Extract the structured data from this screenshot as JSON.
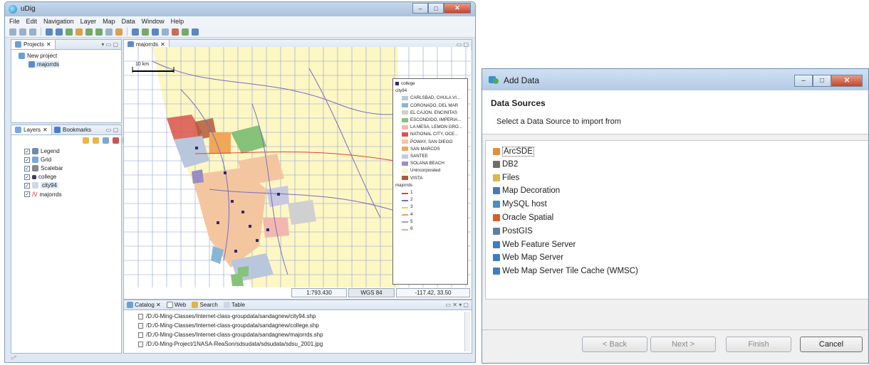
{
  "udig": {
    "title": "uDig",
    "menu": [
      "File",
      "Edit",
      "Navigation",
      "Layer",
      "Map",
      "Data",
      "Window",
      "Help"
    ],
    "projects": {
      "tab_label": "Projects",
      "items": [
        "New project",
        "majorrds"
      ]
    },
    "layers": {
      "tab_label": "Layers",
      "bookmarks_label": "Bookmarks",
      "items": [
        "Legend",
        "Grid",
        "Scalebar",
        "college",
        "city94",
        "majorrds"
      ]
    },
    "map": {
      "tab_label": "majorrds",
      "scalebar_label": "10 km",
      "scale": "1:793.430",
      "crs": "WGS 84",
      "coords": "-117.42, 33.50"
    },
    "legend": {
      "college_label": "college",
      "city_layer": "city94",
      "cities": [
        {
          "name": "CARLSBAD, CHULA VI...",
          "color": "#b9c7dd"
        },
        {
          "name": "CORONADO, DEL MAR",
          "color": "#8ab6d6"
        },
        {
          "name": "EL CAJON, ENCINITAS",
          "color": "#d0d0d0"
        },
        {
          "name": "ESCONDIDO, IMPERIA...",
          "color": "#86c27a"
        },
        {
          "name": "LA MESA, LEMON GRO...",
          "color": "#f2b8b0"
        },
        {
          "name": "NATIONAL CITY, OCE...",
          "color": "#d9534f"
        },
        {
          "name": "POWAY, SAN DIEGO",
          "color": "#f4c6a0"
        },
        {
          "name": "SAN MARCOS",
          "color": "#f0a858"
        },
        {
          "name": "SANTEE",
          "color": "#c8c8e0"
        },
        {
          "name": "SOLANA BEACH",
          "color": "#9a8cc4"
        },
        {
          "name": "Unincorporated",
          "color": "#fdf7c4"
        },
        {
          "name": "VISTA",
          "color": "#b05a3a"
        }
      ],
      "roads_layer": "majorrds",
      "roads": [
        {
          "name": "1",
          "color": "#e0443c"
        },
        {
          "name": "2",
          "color": "#7a6cc0"
        },
        {
          "name": "3",
          "color": "#e7d25c"
        },
        {
          "name": "4",
          "color": "#f0a050"
        },
        {
          "name": "5",
          "color": "#a0a0d0"
        },
        {
          "name": "6",
          "color": "#9ccf8c"
        }
      ]
    },
    "catalog": {
      "tabs": [
        "Catalog",
        "Web",
        "Search",
        "Table"
      ],
      "files": [
        "/D:/0-Ming-Classes/Internet-class-groupdata/sandagnew/city94.shp",
        "/D:/0-Ming-Classes/Internet-class-groupdata/sandagnew/college.shp",
        "/D:/0-Ming-Classes/Internet-class-groupdata/sandagnew/majorrds.shp",
        "/D:/0-Ming-Project/1NASA-ReaSon/sdsudata/sdsudata/sdsu_2001.jpg"
      ]
    }
  },
  "add_data": {
    "title": "Add Data",
    "heading": "Data Sources",
    "subheading": "Select a Data Source to import from",
    "sources": [
      {
        "label": "ArcSDE",
        "icon": "arcsde-icon",
        "color": "#e0903c",
        "selected": true
      },
      {
        "label": "DB2",
        "icon": "db2-icon",
        "color": "#6d6d6d",
        "selected": false
      },
      {
        "label": "Files",
        "icon": "files-icon",
        "color": "#d9b84a",
        "selected": false
      },
      {
        "label": "Map Decoration",
        "icon": "map-decoration-icon",
        "color": "#4a79b8",
        "selected": false
      },
      {
        "label": "MySQL host",
        "icon": "mysql-icon",
        "color": "#4a8fc0",
        "selected": false
      },
      {
        "label": "Oracle Spatial",
        "icon": "oracle-icon",
        "color": "#d0602c",
        "selected": false
      },
      {
        "label": "PostGIS",
        "icon": "postgis-icon",
        "color": "#5f7f9f",
        "selected": false
      },
      {
        "label": "Web Feature Server",
        "icon": "wfs-icon",
        "color": "#3f7fc0",
        "selected": false
      },
      {
        "label": "Web Map Server",
        "icon": "wms-icon",
        "color": "#3f7fc0",
        "selected": false
      },
      {
        "label": "Web Map Server Tile Cache (WMSC)",
        "icon": "wmsc-icon",
        "color": "#3f7fc0",
        "selected": false
      }
    ],
    "buttons": {
      "back": "< Back",
      "next": "Next >",
      "finish": "Finish",
      "cancel": "Cancel"
    }
  }
}
